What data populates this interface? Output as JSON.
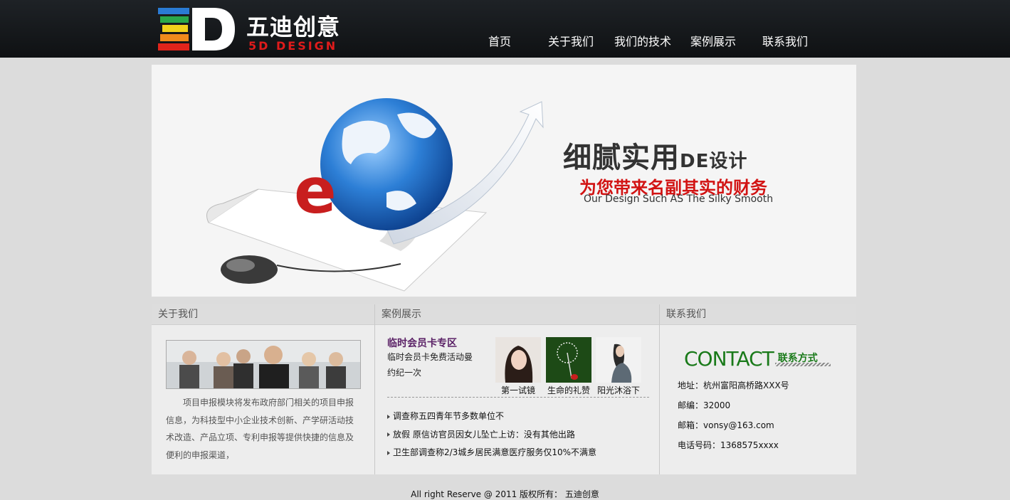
{
  "header": {
    "logo_cn": "五迪创意",
    "logo_en": "5D DESIGN",
    "nav": [
      "首页",
      "关于我们",
      "我们的技术",
      "案例展示",
      "联系我们"
    ]
  },
  "banner": {
    "title_main": "细腻实用",
    "title_suffix": "DE设计",
    "subtitle": "为您带来名副其实的财务",
    "english": "Our Design Such AS The Silky Smooth"
  },
  "about": {
    "heading": "关于我们",
    "text": "项目申报模块将发布政府部门相关的项目申报信息，为科技型中小企业技术创新、产学研活动技术改造、产品立项、专利申报等提供快捷的信息及便利的申报渠道，"
  },
  "cases": {
    "heading": "案例展示",
    "feature_title": "临时会员卡专区",
    "feature_desc": "临时会员卡免费活动曼约纪一次",
    "thumbs": [
      "第一试镜",
      "生命的礼赞",
      "阳光沐浴下"
    ],
    "news": [
      "调查称五四青年节多数单位不",
      "放假 原信访官员因女儿坠亡上访：没有其他出路",
      "卫生部调查称2/3城乡居民满意医疗服务仅10%不满意"
    ]
  },
  "contact": {
    "heading": "联系我们",
    "logo_big": "CONTACT",
    "logo_small": "联系方式",
    "lines": [
      "地址：杭州富阳高桥路XXX号",
      "邮编：32000",
      "邮箱：vonsy@163.com",
      "电话号码：1368575xxxx"
    ]
  },
  "footer": {
    "text": "All right Reserve @ 2011 版权所有：  五迪创意"
  },
  "colors": {
    "header_bg": "#15181b",
    "accent_red": "#d21313",
    "case_title": "#5a2166",
    "contact_green": "#1a7a1a"
  }
}
